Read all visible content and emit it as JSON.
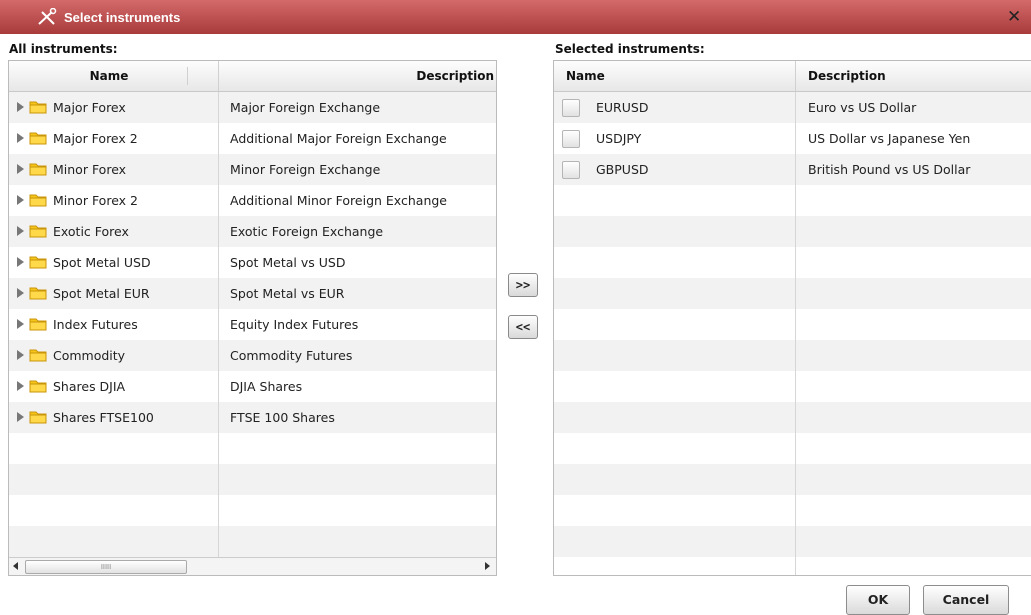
{
  "window": {
    "title": "Select instruments",
    "close_glyph": "✕"
  },
  "left": {
    "label": "All instruments:",
    "columns": {
      "name": "Name",
      "description": "Description"
    },
    "rows": [
      {
        "name": "Major Forex",
        "description": "Major Foreign Exchange"
      },
      {
        "name": "Major Forex 2",
        "description": "Additional Major Foreign Exchange"
      },
      {
        "name": "Minor Forex",
        "description": "Minor Foreign Exchange"
      },
      {
        "name": "Minor Forex 2",
        "description": "Additional Minor Foreign Exchange"
      },
      {
        "name": "Exotic Forex",
        "description": "Exotic Foreign Exchange"
      },
      {
        "name": "Spot Metal USD",
        "description": "Spot Metal vs USD"
      },
      {
        "name": "Spot Metal EUR",
        "description": "Spot Metal vs EUR"
      },
      {
        "name": "Index Futures",
        "description": "Equity Index Futures"
      },
      {
        "name": "Commodity",
        "description": "Commodity Futures"
      },
      {
        "name": "Shares DJIA",
        "description": "DJIA Shares"
      },
      {
        "name": "Shares FTSE100",
        "description": "FTSE 100 Shares"
      }
    ],
    "scroll_grip": "IIIII"
  },
  "right": {
    "label": "Selected instruments:",
    "columns": {
      "name": "Name",
      "description": "Description"
    },
    "rows": [
      {
        "name": "EURUSD",
        "description": "Euro vs US Dollar"
      },
      {
        "name": "USDJPY",
        "description": "US Dollar vs Japanese Yen"
      },
      {
        "name": "GBPUSD",
        "description": "British Pound vs US Dollar"
      }
    ]
  },
  "move": {
    "add_label": ">>",
    "remove_label": "<<"
  },
  "footer": {
    "ok_label": "OK",
    "cancel_label": "Cancel"
  },
  "colors": {
    "titlebar": "#b84848",
    "folder": "#f5c518"
  }
}
